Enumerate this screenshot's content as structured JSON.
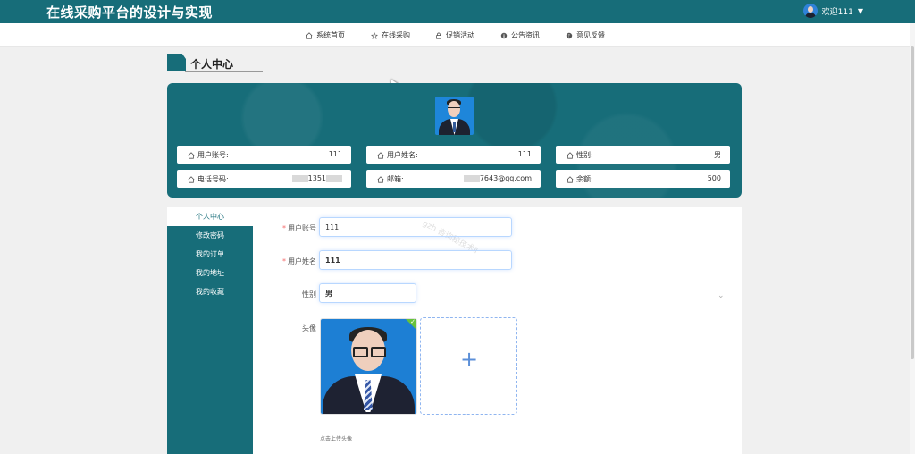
{
  "header": {
    "app_title": "在线采购平台的设计与实现",
    "welcome": "欢迎111"
  },
  "nav": {
    "items": [
      {
        "label": "系统首页",
        "icon": "home-icon"
      },
      {
        "label": "在线采购",
        "icon": "star-icon"
      },
      {
        "label": "促销活动",
        "icon": "lock-icon"
      },
      {
        "label": "公告资讯",
        "icon": "info-icon"
      },
      {
        "label": "意见反馈",
        "icon": "question-icon"
      }
    ]
  },
  "page": {
    "section_title": "个人中心"
  },
  "profile": {
    "fields": [
      {
        "label": "用户账号:",
        "value": "111"
      },
      {
        "label": "用户姓名:",
        "value": "111"
      },
      {
        "label": "性别:",
        "value": "男"
      },
      {
        "label": "电话号码:",
        "value": "1351"
      },
      {
        "label": "邮箱:",
        "value": "7643@qq.com"
      },
      {
        "label": "余额:",
        "value": "500"
      }
    ]
  },
  "sidebar": {
    "items": [
      {
        "label": "个人中心"
      },
      {
        "label": "修改密码"
      },
      {
        "label": "我的订单"
      },
      {
        "label": "我的地址"
      },
      {
        "label": "我的收藏"
      }
    ]
  },
  "form": {
    "account_label": "用户账号",
    "account_value": "111",
    "name_label": "用户姓名",
    "name_value": "111",
    "gender_label": "性别",
    "gender_value": "男",
    "avatar_label": "头像",
    "upload_hint": "点击上传头像"
  },
  "watermark": {
    "text": "gzh 咨询秘技术Ⅱ"
  }
}
